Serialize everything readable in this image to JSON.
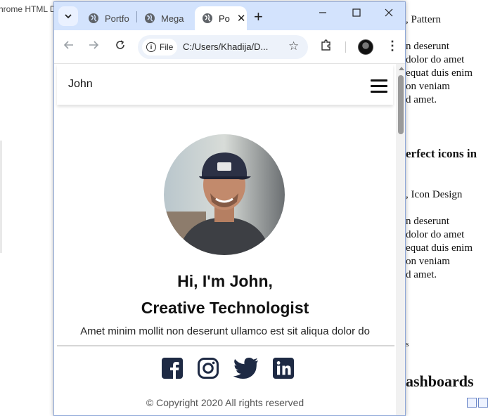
{
  "background": {
    "left_text": "hrome HTML D",
    "right_lines": [
      ", Pattern",
      "n deserunt",
      "dolor do amet",
      "equat duis enim",
      "on veniam",
      "d amet.",
      "erfect icons in",
      ", Icon Design",
      "n deserunt",
      "dolor do amet",
      "equat duis enim",
      "on veniam",
      "d amet.",
      "s",
      "ashboards"
    ]
  },
  "browser": {
    "tabs": [
      {
        "label": "Portfo",
        "active": false
      },
      {
        "label": "Mega",
        "active": false
      },
      {
        "label": "Po",
        "active": true
      }
    ],
    "address": {
      "chip": "File",
      "url": "C:/Users/Khadija/D..."
    }
  },
  "page": {
    "brand": "John",
    "greeting_line1": "Hi, I'm John,",
    "greeting_line2": "Creative Technologist",
    "description": "Amet minim mollit non deserunt ullamco est sit aliqua dolor do",
    "socials": [
      "facebook-icon",
      "instagram-icon",
      "twitter-icon",
      "linkedin-icon"
    ],
    "copyright": "© Copyright 2020 All rights reserved"
  },
  "colors": {
    "tabstrip": "#d3e3fd",
    "icon_dark": "#1e2a44",
    "text": "#111111"
  }
}
